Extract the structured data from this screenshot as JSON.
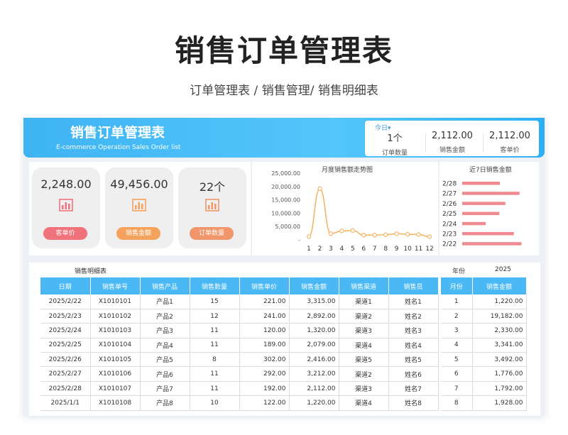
{
  "page": {
    "title": "销售订单管理表",
    "subtitle": "订单管理表 / 销售管理/ 销售明细表"
  },
  "banner": {
    "title": "销售订单管理表",
    "subtitle": "E-commerce Operation Sales Order list"
  },
  "today_kpi": {
    "selector_label": "今日▾",
    "items": [
      {
        "value": "1个",
        "label": "订单数量"
      },
      {
        "value": "2,112.00",
        "label": "销售金额"
      },
      {
        "value": "2,112.00",
        "label": "客单价"
      }
    ]
  },
  "summary_cards": [
    {
      "value": "2,248.00",
      "label": "客单价",
      "icon": "bar-chart-icon",
      "color": "#f0737b"
    },
    {
      "value": "49,456.00",
      "label": "销售金额",
      "icon": "bar-chart-icon",
      "color": "#f5a35c"
    },
    {
      "value": "22个",
      "label": "订单数量",
      "icon": "bar-chart-icon",
      "color": "#f0966a"
    }
  ],
  "charts": {
    "monthly_title": "月度销售额走势图",
    "recent_title": "近7日销售金额"
  },
  "chart_data": [
    {
      "type": "line",
      "title": "月度销售额走势图",
      "x": [
        1,
        2,
        3,
        4,
        5,
        6,
        7,
        8,
        9,
        10,
        11,
        12
      ],
      "values": [
        1220,
        19182,
        2330,
        3341,
        3492,
        1776,
        1792,
        1928,
        2300,
        2100,
        2000,
        1200
      ],
      "yticks": [
        "25,000.00",
        "20,000.00",
        "15,000.00",
        "10,000.00",
        "5,000.00",
        "-"
      ],
      "ylim": [
        0,
        25000
      ],
      "color": "#f3b766"
    },
    {
      "type": "bar",
      "title": "近7日销售金额",
      "categories": [
        "2/28",
        "2/27",
        "2/26",
        "2/25",
        "2/24",
        "2/23",
        "2/22"
      ],
      "values": [
        2112,
        3212,
        2416,
        2079,
        1320,
        2892,
        3315
      ],
      "xlim": [
        0,
        3500
      ],
      "color": "#ef8a90"
    }
  ],
  "detail": {
    "title": "销售明细表",
    "columns": [
      "日期",
      "销售单号",
      "销售产品",
      "销售数量",
      "销售单价",
      "销售金额",
      "销售渠道",
      "销售员"
    ],
    "rows": [
      [
        "2025/2/22",
        "X1010101",
        "产品1",
        "15",
        "221.00",
        "3,315.00",
        "渠道1",
        "姓名1"
      ],
      [
        "2025/2/23",
        "X1010102",
        "产品2",
        "12",
        "241.00",
        "2,892.00",
        "渠道2",
        "姓名2"
      ],
      [
        "2025/2/24",
        "X1010103",
        "产品3",
        "11",
        "120.00",
        "1,320.00",
        "渠道3",
        "姓名3"
      ],
      [
        "2025/2/25",
        "X1010104",
        "产品4",
        "11",
        "189.00",
        "2,079.00",
        "渠道4",
        "姓名4"
      ],
      [
        "2025/2/26",
        "X1010105",
        "产品5",
        "8",
        "302.00",
        "2,416.00",
        "渠道5",
        "姓名5"
      ],
      [
        "2025/2/27",
        "X1010106",
        "产品6",
        "11",
        "292.00",
        "3,212.00",
        "渠道2",
        "姓名6"
      ],
      [
        "2025/2/28",
        "X1010107",
        "产品7",
        "11",
        "192.00",
        "2,112.00",
        "渠道3",
        "姓名7"
      ],
      [
        "2025/1/1",
        "X1010108",
        "产品8",
        "10",
        "122.00",
        "1,220.00",
        "渠道4",
        "姓名8"
      ]
    ]
  },
  "monthly": {
    "year_label": "年份",
    "year_value": "2025",
    "columns": [
      "月份",
      "销售金额"
    ],
    "rows": [
      [
        "1",
        "1,220.00"
      ],
      [
        "2",
        "19,182.00"
      ],
      [
        "3",
        "2,330.00"
      ],
      [
        "4",
        "3,341.00"
      ],
      [
        "5",
        "3,492.00"
      ],
      [
        "6",
        "1,776.00"
      ],
      [
        "7",
        "1,792.00"
      ],
      [
        "8",
        "1,928.00"
      ]
    ]
  }
}
